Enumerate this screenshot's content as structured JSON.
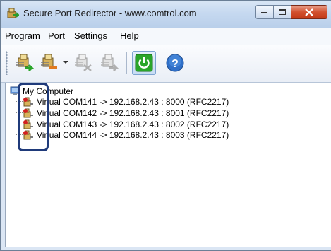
{
  "window": {
    "title": "Secure Port Redirector - www.comtrol.com"
  },
  "menu": [
    {
      "label": "Program",
      "underline": "P",
      "rest": "rogram"
    },
    {
      "label": "Port",
      "underline": "P",
      "rest": "ort"
    },
    {
      "label": "Settings",
      "underline": "S",
      "rest": "ettings"
    },
    {
      "label": "Help",
      "underline": "H",
      "rest": "elp"
    }
  ],
  "toolbar": {
    "icons": [
      "add-port-icon",
      "remove-port-icon",
      "port-disabled-icon",
      "port-edit-icon",
      "power-icon",
      "help-icon"
    ]
  },
  "tree": {
    "root": "My Computer",
    "items": [
      {
        "label": "Virtual COM141 -> 192.168.2.43 : 8000 (RFC2217)"
      },
      {
        "label": "Virtual COM142 -> 192.168.2.43 : 8001 (RFC2217)"
      },
      {
        "label": "Virtual COM143 -> 192.168.2.43 : 8002 (RFC2217)"
      },
      {
        "label": "Virtual COM144 -> 192.168.2.43 : 8003 (RFC2217)"
      }
    ]
  },
  "colors": {
    "accent_green": "#2aa52a",
    "highlight_border": "#1f3a7a",
    "close_red": "#c33a18"
  }
}
